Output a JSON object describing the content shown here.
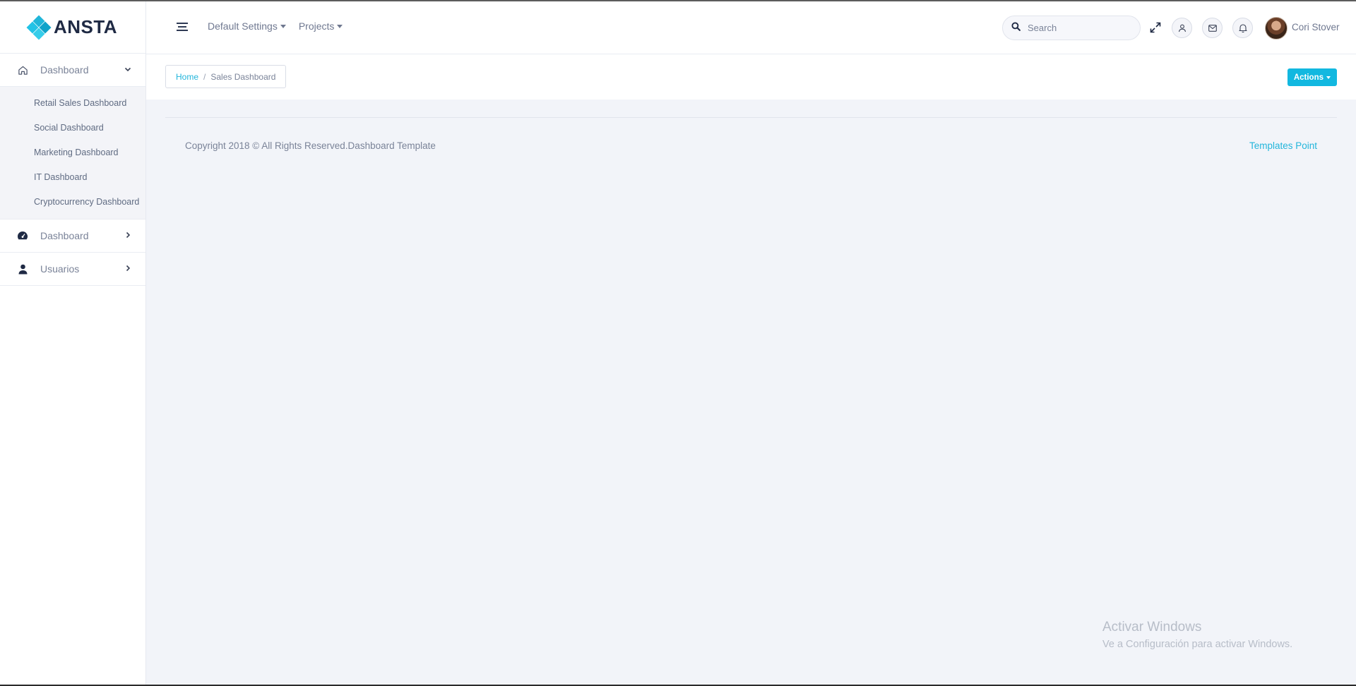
{
  "brand": {
    "name": "ANSTA",
    "accent": "#12b8e0"
  },
  "sidebar": {
    "groups": [
      {
        "label": "Dashboard",
        "icon": "home-icon",
        "expanded": true,
        "items": [
          {
            "label": "Retail Sales Dashboard"
          },
          {
            "label": "Social Dashboard"
          },
          {
            "label": "Marketing Dashboard"
          },
          {
            "label": "IT Dashboard"
          },
          {
            "label": "Cryptocurrency Dashboard"
          }
        ]
      },
      {
        "label": "Dashboard",
        "icon": "speedometer-icon",
        "expanded": false
      },
      {
        "label": "Usuarios",
        "icon": "user-icon",
        "expanded": false
      }
    ]
  },
  "topbar": {
    "menus": [
      {
        "label": "Default Settings"
      },
      {
        "label": "Projects"
      }
    ],
    "search": {
      "placeholder": "Search"
    },
    "icons": [
      "hamburger-icon",
      "expand-icon",
      "profile-icon",
      "mail-icon",
      "bell-icon"
    ],
    "user": {
      "name": "Cori Stover"
    }
  },
  "breadcrumb": {
    "home": "Home",
    "separator": "/",
    "current": "Sales Dashboard"
  },
  "actions": {
    "label": "Actions"
  },
  "footer": {
    "copyright": "Copyright 2018 © All Rights Reserved.Dashboard Template",
    "link": "Templates Point"
  },
  "watermark": {
    "title": "Activar Windows",
    "subtitle": "Ve a Configuración para activar Windows."
  }
}
